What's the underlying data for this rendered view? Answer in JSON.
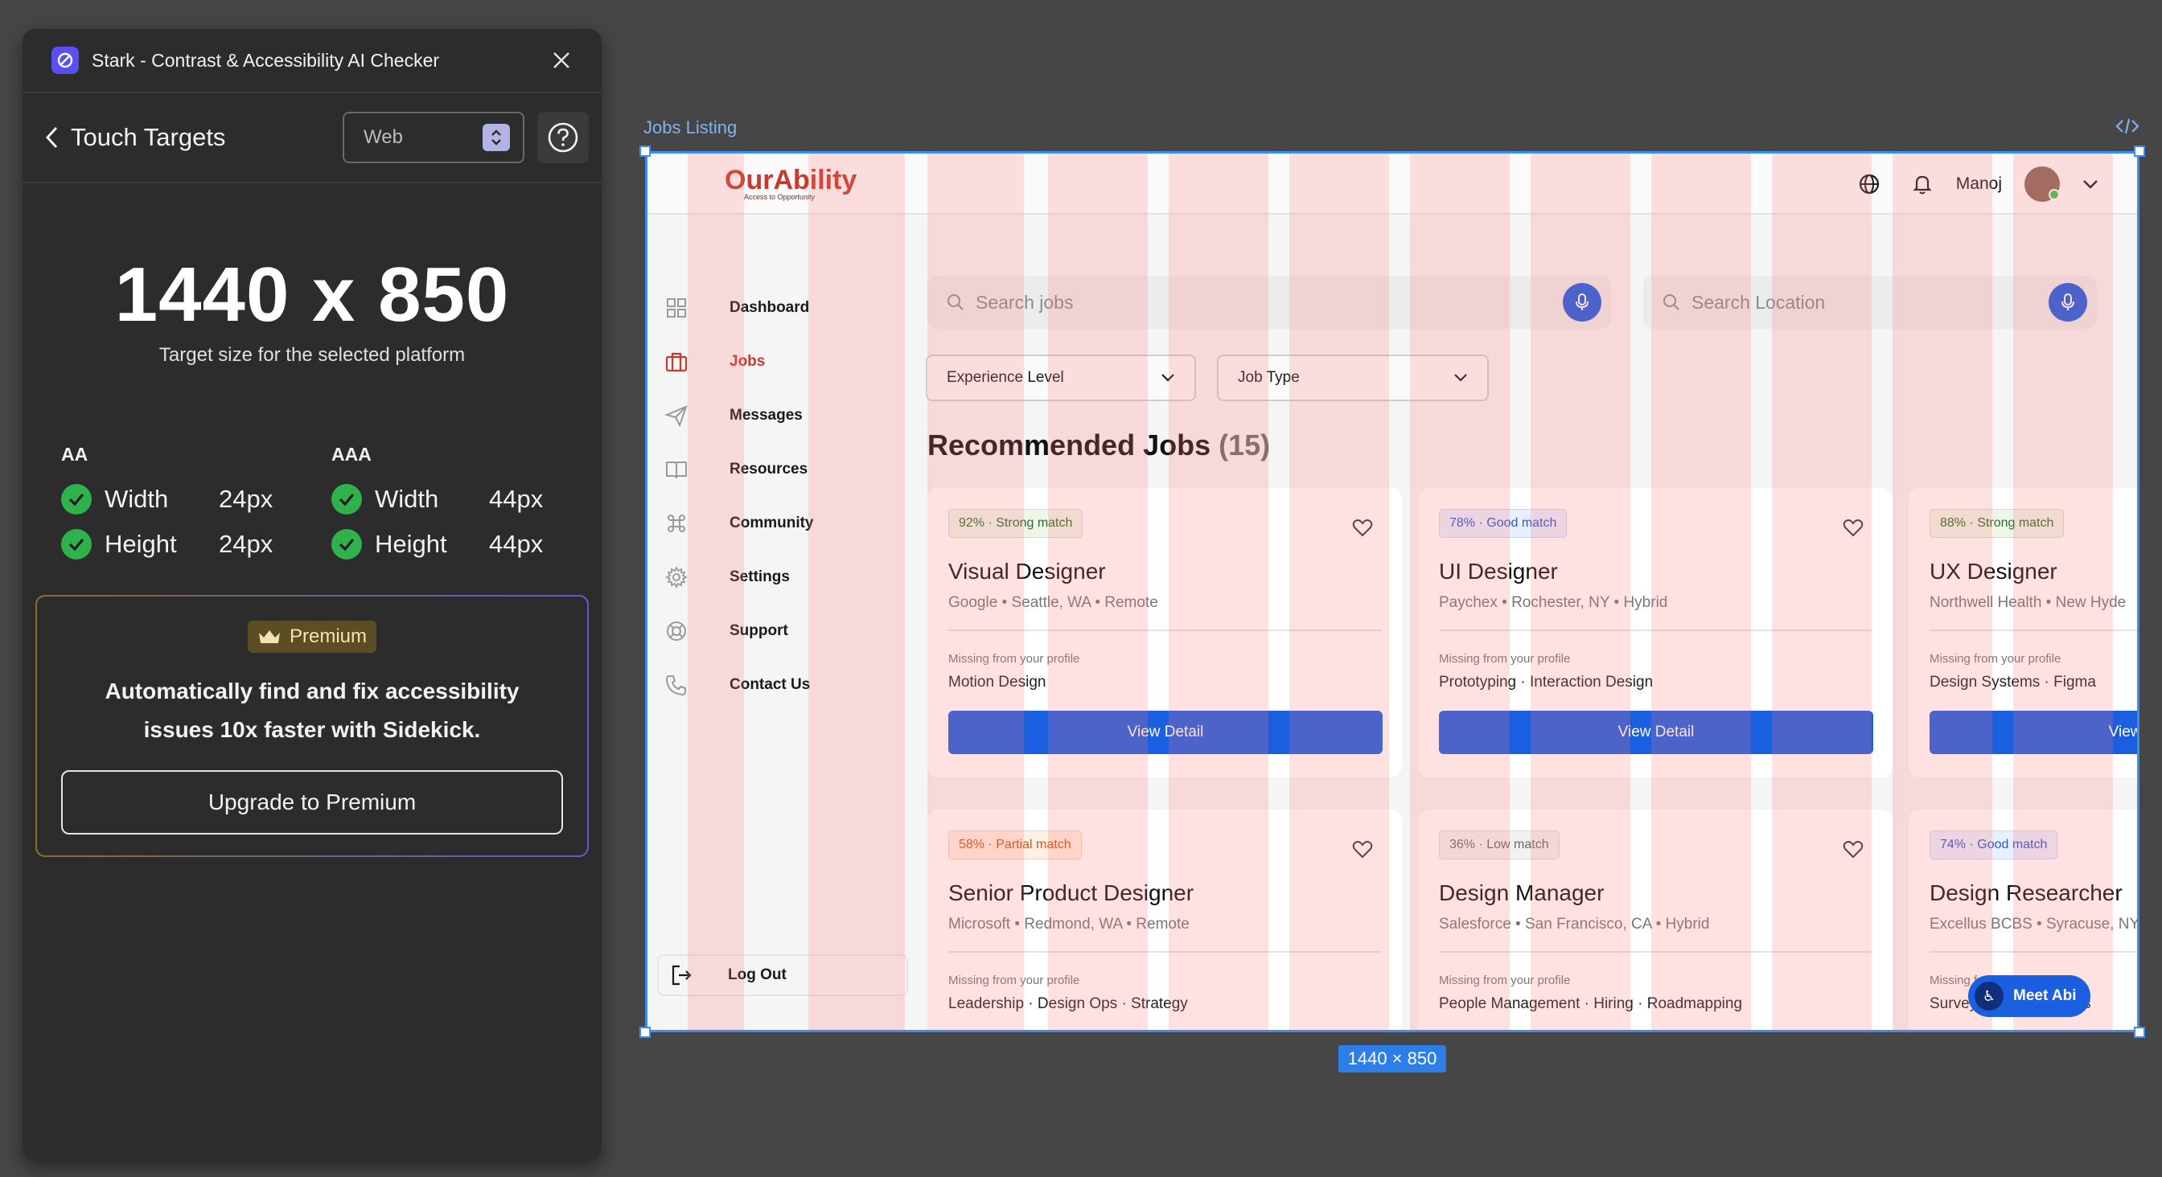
{
  "plugin": {
    "title": "Stark - Contrast & Accessibility AI Checker",
    "section": "Touch Targets",
    "platform": "Web",
    "target_size": "1440 x 850",
    "target_caption": "Target size for the selected platform",
    "levels": [
      {
        "name": "AA",
        "rows": [
          {
            "label": "Width",
            "value": "24px"
          },
          {
            "label": "Height",
            "value": "24px"
          }
        ]
      },
      {
        "name": "AAA",
        "rows": [
          {
            "label": "Width",
            "value": "44px"
          },
          {
            "label": "Height",
            "value": "44px"
          }
        ]
      }
    ],
    "premium": {
      "badge": "Premium",
      "text_line1": "Automatically find and fix accessibility",
      "text_line2": "issues 10x faster with Sidekick.",
      "button": "Upgrade to Premium"
    }
  },
  "frame": {
    "label": "Jobs Listing",
    "size_chip": "1440 × 850"
  },
  "app": {
    "brand": "OurAbility",
    "tagline": "Access to Opportunity",
    "user": "Manoj",
    "nav": [
      "Dashboard",
      "Jobs",
      "Messages",
      "Resources",
      "Community",
      "Settings",
      "Support",
      "Contact Us"
    ],
    "logout": "Log Out",
    "search_jobs": "Search jobs",
    "search_location": "Search Location",
    "filters": [
      "Experience Level",
      "Job Type"
    ],
    "section_title": "Recommended Jobs",
    "section_count": "(15)",
    "missing_label": "Missing from your profile",
    "view_label": "View Detail",
    "meet_abi": "Meet Abi",
    "jobs": [
      {
        "match": "92%  ·  Strong match",
        "title": "Visual Designer",
        "meta": "Google   •   Seattle, WA   •   Remote",
        "missing": "Motion Design"
      },
      {
        "match": "78%  ·  Good match",
        "title": "UI Designer",
        "meta": "Paychex   •   Rochester, NY   •   Hybrid",
        "missing": "Prototyping  · Interaction Design"
      },
      {
        "match": "88%  ·  Strong match",
        "title": "UX Designer",
        "meta": "Northwell Health   •   New Hyde",
        "missing": "Design Systems · Figma"
      },
      {
        "match": "58%  ·  Partial match",
        "title": "Senior Product Designer",
        "meta": "Microsoft   •   Redmond, WA   •   Remote",
        "missing": "Leadership · Design Ops · Strategy"
      },
      {
        "match": "36%  ·  Low match",
        "title": "Design Manager",
        "meta": "Salesforce   •   San Francisco, CA   •   Hybrid",
        "missing": "People Management · Hiring · Roadmapping"
      },
      {
        "match": "74%  ·  Good match",
        "title": "Design Researcher",
        "meta": "Excellus BCBS   •   Syracuse, NY",
        "missing": "Surveys · Data Analysis"
      }
    ]
  }
}
